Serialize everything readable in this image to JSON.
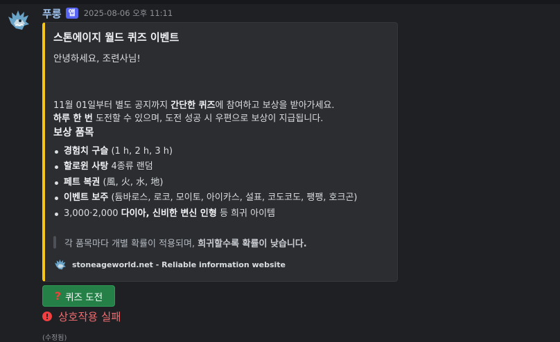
{
  "message": {
    "username": "푸룽",
    "badge": "앱",
    "timestamp": "2025-08-06 오후 11:11",
    "edited": "(수정됨)"
  },
  "embed": {
    "accent_color": "#f5c518",
    "title": "스톤에이지 월드 퀴즈 이벤트",
    "greeting": "안녕하세요, 조련사님!",
    "line1": {
      "pre": "11월 01일부터 별도 공지까지 ",
      "bold1": "간단한 퀴즈",
      "post": "에 참여하고 보상을 받아가세요."
    },
    "line2": {
      "bold1": "하루 한 번",
      "post": " 도전할 수 있으며, 도전 성공 시 우편으로 보상이 지급됩니다."
    },
    "rewards_title": "보상 품목",
    "rewards": [
      {
        "bold": "경험치 구슬",
        "rest": " (1 h, 2 h, 3 h)"
      },
      {
        "bold": "할로윈 사탕",
        "rest": " 4종류 랜덤"
      },
      {
        "bold": "페트 복권",
        "rest": " (風, 火, 水, 地)"
      },
      {
        "bold": "이벤트 보주",
        "rest": " (듐바로스, 로코, 모이토, 아이카스, 설표, 코도코도, 팽팽, 호크곤)"
      },
      {
        "pre": "3,000·2,000 ",
        "bold": "다이아, 신비한 변신 인형",
        "rest": " 등 희귀 아이템"
      }
    ],
    "quote": {
      "pre": "각 품목마다 개별 확률이 적용되며, ",
      "bold": "희귀할수록 확률이 낮습니다."
    },
    "footer_text": "stoneageworld.net - Reliable information website"
  },
  "buttons": {
    "quiz": {
      "icon": "question-icon",
      "label": "퀴즈 도전",
      "color": "#248046"
    }
  },
  "interaction": {
    "fail_icon": "error-icon",
    "fail_text": "상호작용 실패",
    "fail_color": "#f23f42"
  }
}
